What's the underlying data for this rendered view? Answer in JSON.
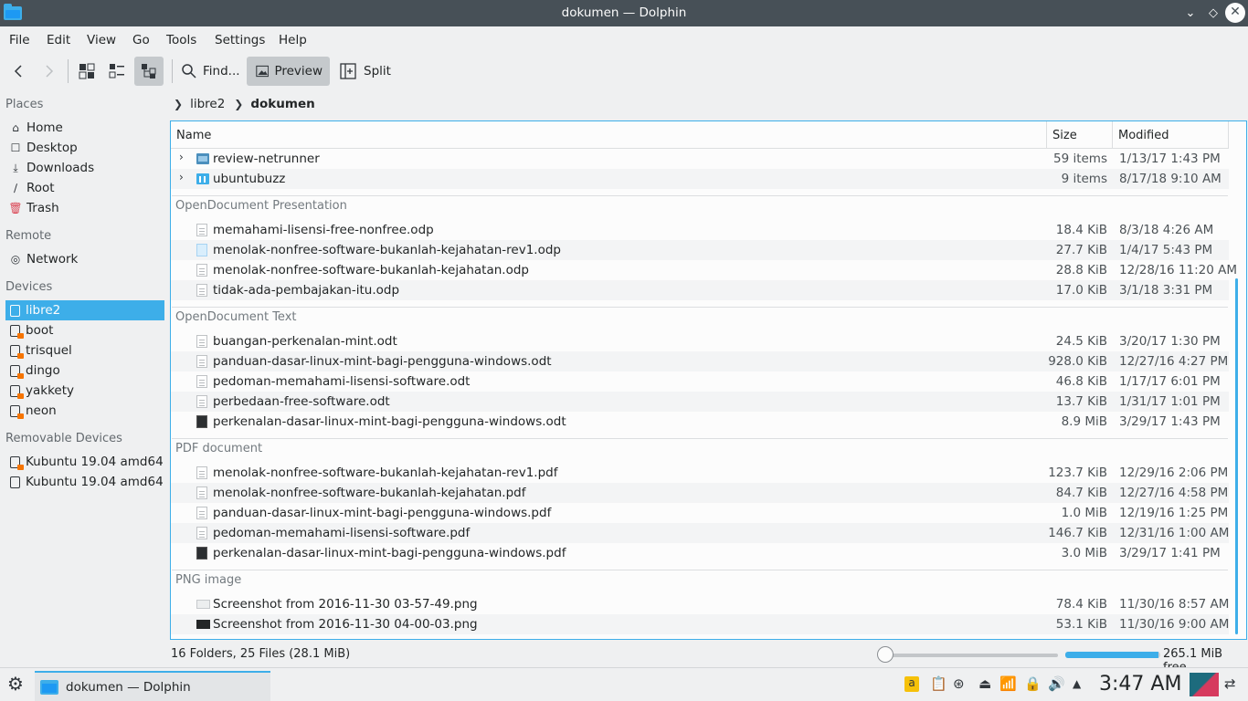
{
  "window": {
    "title": "dokumen — Dolphin"
  },
  "menu": [
    "File",
    "Edit",
    "View",
    "Go",
    "Tools",
    "Settings",
    "Help"
  ],
  "toolbar": {
    "find": "Find...",
    "preview": "Preview",
    "split": "Split"
  },
  "sidebar": {
    "places_header": "Places",
    "places": [
      "Home",
      "Desktop",
      "Downloads",
      "Root",
      "Trash"
    ],
    "remote_header": "Remote",
    "remote": [
      "Network"
    ],
    "devices_header": "Devices",
    "devices": [
      "libre2",
      "boot",
      "trisquel",
      "dingo",
      "yakkety",
      "neon"
    ],
    "removable_header": "Removable Devices",
    "removable": [
      "Kubuntu 19.04 amd64",
      "Kubuntu 19.04 amd64"
    ]
  },
  "breadcrumb": {
    "parent": "libre2",
    "current": "dokumen"
  },
  "columns": {
    "name": "Name",
    "size": "Size",
    "modified": "Modified"
  },
  "folders": [
    {
      "name": "review-netrunner",
      "size": "59 items",
      "modified": "1/13/17 1:43 PM"
    },
    {
      "name": "ubuntubuzz",
      "size": "9 items",
      "modified": "8/17/18 9:10 AM"
    }
  ],
  "groups": {
    "odp": {
      "title": "OpenDocument Presentation",
      "files": [
        {
          "name": "memahami-lisensi-free-nonfree.odp",
          "size": "18.4 KiB",
          "modified": "8/3/18 4:26 AM"
        },
        {
          "name": "menolak-nonfree-software-bukanlah-kejahatan-rev1.odp",
          "size": "27.7 KiB",
          "modified": "1/4/17 5:43 PM"
        },
        {
          "name": "menolak-nonfree-software-bukanlah-kejahatan.odp",
          "size": "28.8 KiB",
          "modified": "12/28/16 11:20 AM"
        },
        {
          "name": "tidak-ada-pembajakan-itu.odp",
          "size": "17.0 KiB",
          "modified": "3/1/18 3:31 PM"
        }
      ]
    },
    "odt": {
      "title": "OpenDocument Text",
      "files": [
        {
          "name": "buangan-perkenalan-mint.odt",
          "size": "24.5 KiB",
          "modified": "3/20/17 1:30 PM"
        },
        {
          "name": "panduan-dasar-linux-mint-bagi-pengguna-windows.odt",
          "size": "928.0 KiB",
          "modified": "12/27/16 4:27 PM"
        },
        {
          "name": "pedoman-memahami-lisensi-software.odt",
          "size": "46.8 KiB",
          "modified": "1/17/17 6:01 PM"
        },
        {
          "name": "perbedaan-free-software.odt",
          "size": "13.7 KiB",
          "modified": "1/31/17 1:01 PM"
        },
        {
          "name": "perkenalan-dasar-linux-mint-bagi-pengguna-windows.odt",
          "size": "8.9 MiB",
          "modified": "3/29/17 1:43 PM"
        }
      ]
    },
    "pdf": {
      "title": "PDF document",
      "files": [
        {
          "name": "menolak-nonfree-software-bukanlah-kejahatan-rev1.pdf",
          "size": "123.7 KiB",
          "modified": "12/29/16 2:06 PM"
        },
        {
          "name": "menolak-nonfree-software-bukanlah-kejahatan.pdf",
          "size": "84.7 KiB",
          "modified": "12/27/16 4:58 PM"
        },
        {
          "name": "panduan-dasar-linux-mint-bagi-pengguna-windows.pdf",
          "size": "1.0 MiB",
          "modified": "12/19/16 1:25 PM"
        },
        {
          "name": "pedoman-memahami-lisensi-software.pdf",
          "size": "146.7 KiB",
          "modified": "12/31/16 1:00 AM"
        },
        {
          "name": "perkenalan-dasar-linux-mint-bagi-pengguna-windows.pdf",
          "size": "3.0 MiB",
          "modified": "3/29/17 1:41 PM"
        }
      ]
    },
    "png": {
      "title": "PNG image",
      "files": [
        {
          "name": "Screenshot from 2016-11-30 03-57-49.png",
          "size": "78.4 KiB",
          "modified": "11/30/16 8:57 AM"
        },
        {
          "name": "Screenshot from 2016-11-30 04-00-03.png",
          "size": "53.1 KiB",
          "modified": "11/30/16 9:00 AM"
        }
      ]
    }
  },
  "status": {
    "summary": "16 Folders, 25 Files (28.1 MiB)",
    "free": "265.1 MiB free",
    "free_used_fraction": 0.98
  },
  "taskbar": {
    "task": "dokumen — Dolphin",
    "clock": "3:47 AM"
  },
  "colors": {
    "accent": "#3daee9",
    "titlebar": "#475057"
  }
}
